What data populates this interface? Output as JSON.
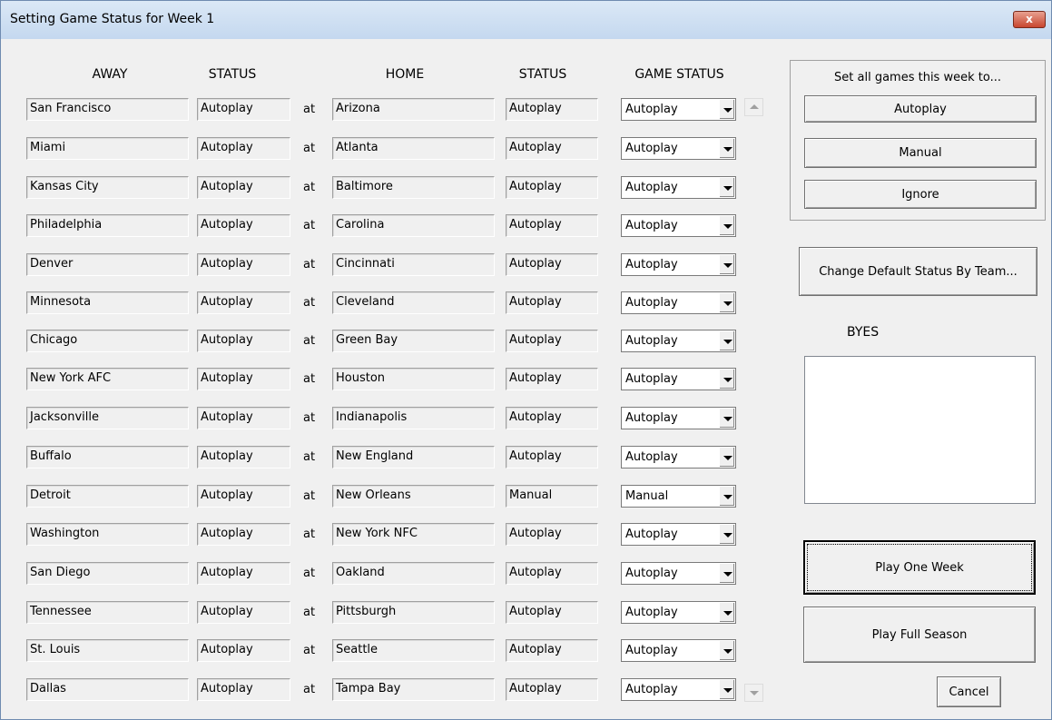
{
  "window": {
    "title": "Setting Game Status for Week 1",
    "close_label": "x"
  },
  "headers": {
    "away": "AWAY",
    "away_status": "STATUS",
    "home": "HOME",
    "home_status": "STATUS",
    "game_status": "GAME STATUS"
  },
  "at_label": "at",
  "games": [
    {
      "away": "San Francisco",
      "away_status": "Autoplay",
      "home": "Arizona",
      "home_status": "Autoplay",
      "game_status": "Autoplay"
    },
    {
      "away": "Miami",
      "away_status": "Autoplay",
      "home": "Atlanta",
      "home_status": "Autoplay",
      "game_status": "Autoplay"
    },
    {
      "away": "Kansas City",
      "away_status": "Autoplay",
      "home": "Baltimore",
      "home_status": "Autoplay",
      "game_status": "Autoplay"
    },
    {
      "away": "Philadelphia",
      "away_status": "Autoplay",
      "home": "Carolina",
      "home_status": "Autoplay",
      "game_status": "Autoplay"
    },
    {
      "away": "Denver",
      "away_status": "Autoplay",
      "home": "Cincinnati",
      "home_status": "Autoplay",
      "game_status": "Autoplay"
    },
    {
      "away": "Minnesota",
      "away_status": "Autoplay",
      "home": "Cleveland",
      "home_status": "Autoplay",
      "game_status": "Autoplay"
    },
    {
      "away": "Chicago",
      "away_status": "Autoplay",
      "home": "Green Bay",
      "home_status": "Autoplay",
      "game_status": "Autoplay"
    },
    {
      "away": "New York AFC",
      "away_status": "Autoplay",
      "home": "Houston",
      "home_status": "Autoplay",
      "game_status": "Autoplay"
    },
    {
      "away": "Jacksonville",
      "away_status": "Autoplay",
      "home": "Indianapolis",
      "home_status": "Autoplay",
      "game_status": "Autoplay"
    },
    {
      "away": "Buffalo",
      "away_status": "Autoplay",
      "home": "New England",
      "home_status": "Autoplay",
      "game_status": "Autoplay"
    },
    {
      "away": "Detroit",
      "away_status": "Autoplay",
      "home": "New Orleans",
      "home_status": "Manual",
      "game_status": "Manual"
    },
    {
      "away": "Washington",
      "away_status": "Autoplay",
      "home": "New York NFC",
      "home_status": "Autoplay",
      "game_status": "Autoplay"
    },
    {
      "away": "San Diego",
      "away_status": "Autoplay",
      "home": "Oakland",
      "home_status": "Autoplay",
      "game_status": "Autoplay"
    },
    {
      "away": "Tennessee",
      "away_status": "Autoplay",
      "home": "Pittsburgh",
      "home_status": "Autoplay",
      "game_status": "Autoplay"
    },
    {
      "away": "St. Louis",
      "away_status": "Autoplay",
      "home": "Seattle",
      "home_status": "Autoplay",
      "game_status": "Autoplay"
    },
    {
      "away": "Dallas",
      "away_status": "Autoplay",
      "home": "Tampa Bay",
      "home_status": "Autoplay",
      "game_status": "Autoplay"
    }
  ],
  "set_all": {
    "label": "Set all games this week to...",
    "autoplay": "Autoplay",
    "manual": "Manual",
    "ignore": "Ignore"
  },
  "change_default_label": "Change Default Status By Team...",
  "byes_label": "BYES",
  "play_one_week_label": "Play One Week",
  "play_full_season_label": "Play Full Season",
  "cancel_label": "Cancel"
}
